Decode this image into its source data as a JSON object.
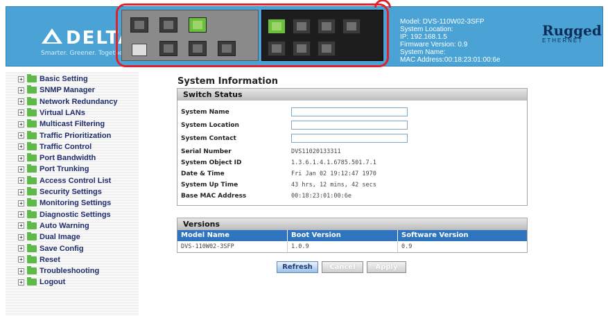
{
  "header": {
    "brand": "DELTA",
    "tagline": "Smarter. Greener. Together.",
    "system": {
      "model": "Model: DVS-110W02-3SFP",
      "location": "System Location:",
      "ip": "IP: 192.168.1.5",
      "firmware": "Firmware Version: 0.9",
      "name": "System Name:",
      "mac": "MAC Address:00:18:23:01:00:6e"
    },
    "partner_logo_top": "Rugged",
    "partner_logo_bottom": "ETHERNET"
  },
  "sidebar": {
    "items": [
      {
        "label": "Basic Setting"
      },
      {
        "label": "SNMP Manager"
      },
      {
        "label": "Network Redundancy"
      },
      {
        "label": "Virtual LANs"
      },
      {
        "label": "Multicast Filtering"
      },
      {
        "label": "Traffic Prioritization"
      },
      {
        "label": "Traffic Control"
      },
      {
        "label": "Port Bandwidth"
      },
      {
        "label": "Port Trunking"
      },
      {
        "label": "Access Control List"
      },
      {
        "label": "Security Settings"
      },
      {
        "label": "Monitoring Settings"
      },
      {
        "label": "Diagnostic Settings"
      },
      {
        "label": "Auto Warning"
      },
      {
        "label": "Dual Image"
      },
      {
        "label": "Save Config"
      },
      {
        "label": "Reset"
      },
      {
        "label": "Troubleshooting"
      },
      {
        "label": "Logout"
      }
    ]
  },
  "main": {
    "title": "System Information",
    "switch_status": {
      "heading": "Switch Status",
      "rows": [
        {
          "label": "System Name",
          "value": ""
        },
        {
          "label": "System Location",
          "value": ""
        },
        {
          "label": "System Contact",
          "value": ""
        },
        {
          "label": "Serial Number",
          "value": "DVS11020133311"
        },
        {
          "label": "System Object ID",
          "value": "1.3.6.1.4.1.6785.501.7.1"
        },
        {
          "label": "Date & Time",
          "value": "Fri Jan 02 19:12:47 1970"
        },
        {
          "label": "System Up Time",
          "value": "43 hrs, 12 mins, 42 secs"
        },
        {
          "label": "Base MAC Address",
          "value": "00:18:23:01:00:6e"
        }
      ]
    },
    "versions": {
      "heading": "Versions",
      "columns": [
        "Model Name",
        "Boot Version",
        "Software Version"
      ],
      "row": [
        "DVS-110W02-3SFP",
        "1.0.9",
        "0.9"
      ]
    },
    "buttons": {
      "refresh": "Refresh",
      "cancel": "Cancel",
      "apply": "Apply"
    }
  },
  "colors": {
    "header_bg": "#4aa3d4",
    "table_header": "#2f74be",
    "nav_text": "#1f2d6b",
    "highlight_frame": "#e0202a"
  }
}
